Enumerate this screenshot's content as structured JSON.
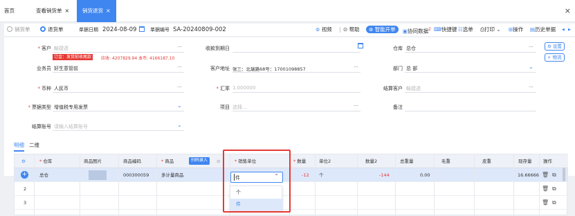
{
  "tabs": [
    {
      "label": "首页",
      "closable": false,
      "active": false
    },
    {
      "label": "查看销货单",
      "closable": true,
      "active": false
    },
    {
      "label": "销货退货",
      "closable": true,
      "active": true
    }
  ],
  "close_glyph": "×",
  "window_close": "×",
  "toolbar": {
    "radio_sales": "销货单",
    "radio_return": "退货单",
    "date_label": "单据日期",
    "date_value": "2024-08-09",
    "number_label": "单据编号",
    "number_value": "SA-20240809-002",
    "video": "视频",
    "separator": "|",
    "help": "帮助",
    "smart": "智能开单",
    "sync": "协同数据",
    "sync_badge": "2",
    "shortcut": "快捷键",
    "select": "选单",
    "print": "打印",
    "ops": "操作",
    "history": "历史单据",
    "prev": "◀",
    "next": "▶"
  },
  "form": {
    "customer_label": "客户",
    "customer_placeholder": "輸捷透",
    "customer_tag": "订金：发货前收尾款",
    "customer_receivable": "应收: 4207829.94  本币: 4166187.10",
    "due_label": "收款到期日",
    "warehouse_label": "仓库",
    "warehouse_value": "总仓",
    "salesman_label": "业务员",
    "salesman_value": "好生意管前",
    "address_label": "客户地址",
    "address_value": "张三：北瑞路68号：17001098857",
    "dept_label": "部门",
    "dept_value": "总 部",
    "currency_label": "币种",
    "currency_value": "人民币",
    "rate_label": "汇率",
    "rate_value": "1.000000",
    "settle_customer_label": "结算客户",
    "settle_customer_placeholder": "輸捷透",
    "invoice_label": "票据类型",
    "invoice_value": "增值税专用发票",
    "project_label": "项目",
    "project_placeholder": "选择...",
    "remark_label": "备注",
    "account_label": "结算账号",
    "account_placeholder": "请输入结算账号",
    "settings_btn": "设置",
    "logistics_btn": "+ 物流"
  },
  "subtabs": [
    "明细",
    "二维"
  ],
  "grid": {
    "headers": [
      "",
      "仓库",
      "商品图片",
      "商品编码",
      "商品",
      "销售单位",
      "数量",
      "单位2",
      "数量2",
      "总重量",
      "毛重",
      "皮重",
      "现存量",
      "操作"
    ],
    "scan_btn": "扫码录入",
    "rows": [
      {
        "no": "",
        "warehouse": "总仓",
        "code": "000300059",
        "product": "多计量商品",
        "unit": "件",
        "qty": "-12",
        "unit2": "个",
        "qty2": "-144",
        "weight": "0.00",
        "stock": "16.666667"
      },
      {
        "no": "2",
        "warehouse": "",
        "code": "",
        "product": "",
        "unit": "",
        "qty": "",
        "unit2": "",
        "qty2": "",
        "weight": "",
        "stock": ""
      },
      {
        "no": "3",
        "warehouse": "",
        "code": "",
        "product": "",
        "unit": "",
        "qty": "",
        "unit2": "",
        "qty2": "",
        "weight": "",
        "stock": ""
      }
    ],
    "unit_options": [
      "个",
      "件"
    ],
    "highlighted_option": "件"
  },
  "colors": {
    "accent": "#3f86f0",
    "danger": "#e53935",
    "highlight": "#dde8fa"
  }
}
